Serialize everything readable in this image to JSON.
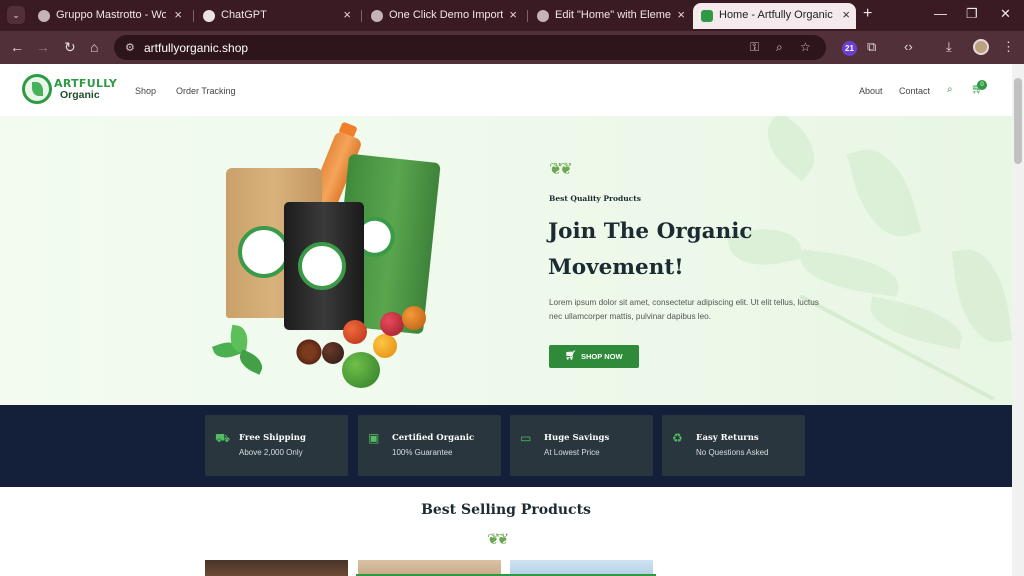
{
  "browser": {
    "tabs": [
      {
        "title": "Gruppo Mastrotto - World le",
        "active": false
      },
      {
        "title": "ChatGPT",
        "active": false
      },
      {
        "title": "One Click Demo Import ‹ Ru",
        "active": false
      },
      {
        "title": "Edit \"Home\" with Elementor",
        "active": false
      },
      {
        "title": "Home - Artfully Organic",
        "active": true
      }
    ],
    "url": "artfullyorganic.shop",
    "extension_badge": "21"
  },
  "site": {
    "logo": {
      "line1": "ARTFULLY",
      "line2": "Organic"
    },
    "nav_left": [
      "Shop",
      "Order Tracking"
    ],
    "nav_right": [
      "About",
      "Contact"
    ],
    "cart_count": "0"
  },
  "hero": {
    "kicker": "Best Quality Products",
    "title": "Join The Organic Movement!",
    "body": "Lorem ipsum dolor sit amet, consectetur adipiscing elit. Ut elit tellus, luctus nec ullamcorper mattis, pulvinar dapibus leo.",
    "cta": "SHOP NOW"
  },
  "features": [
    {
      "icon": "truck-icon",
      "title": "Free Shipping",
      "subtitle": "Above 2,000 Only"
    },
    {
      "icon": "certificate-icon",
      "title": "Certified Organic",
      "subtitle": "100% Guarantee"
    },
    {
      "icon": "money-icon",
      "title": "Huge Savings",
      "subtitle": "At Lowest Price"
    },
    {
      "icon": "recycle-icon",
      "title": "Easy Returns",
      "subtitle": "No Questions Asked"
    }
  ],
  "best_selling": {
    "title": "Best Selling Products"
  },
  "colors": {
    "brand_green": "#2f9a44",
    "band_navy": "#14203a",
    "card_gray": "#2a363d",
    "tab_bar": "#3a1a23"
  }
}
